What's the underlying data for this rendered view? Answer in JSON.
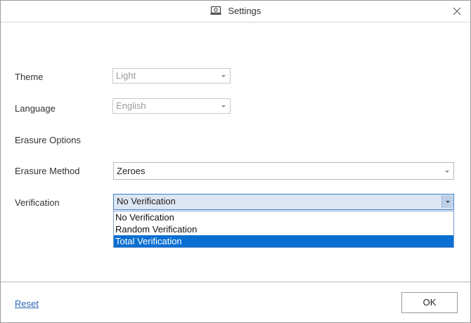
{
  "window": {
    "title": "Settings",
    "title_icon": "settings-app-icon",
    "close_icon": "close-icon"
  },
  "settings": {
    "theme_label": "Theme",
    "theme_value": "Light",
    "language_label": "Language",
    "language_value": "English",
    "erasure_options_label": "Erasure Options",
    "erasure_method_label": "Erasure Method",
    "erasure_method_value": "Zeroes",
    "verification_label": "Verification",
    "verification_value": "No Verification"
  },
  "verification_dropdown": {
    "options": [
      "No Verification",
      "Random Verification",
      "Total Verification"
    ],
    "highlighted": "Total Verification"
  },
  "footer": {
    "reset_label": "Reset",
    "ok_label": "OK"
  },
  "colors": {
    "accent": "#0a6fd2",
    "link": "#2a66b5",
    "active_combo_bg": "#dde6f3"
  }
}
